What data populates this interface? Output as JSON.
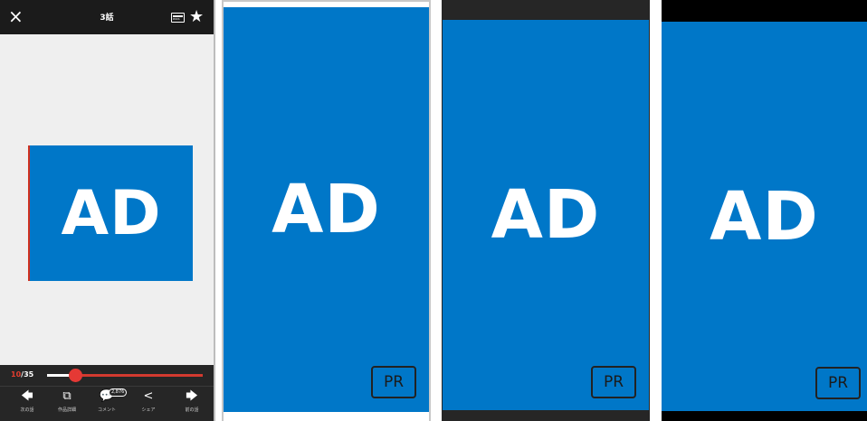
{
  "reader": {
    "close_icon": "×",
    "title": "3話",
    "pass_icon": "PASS",
    "star_icon": "★",
    "ad_text": "AD",
    "page_current": "10",
    "page_total": "/35",
    "progress_fraction": 0.18,
    "nav": [
      {
        "icon": "🡄",
        "label": "次の話"
      },
      {
        "icon": "⧉",
        "label": "作品詳細"
      },
      {
        "icon": "💬",
        "label": "コメント",
        "badge": "2,876"
      },
      {
        "icon": "<",
        "label": "シェア"
      },
      {
        "icon": "🡆",
        "label": "前の話"
      }
    ]
  },
  "ads": [
    {
      "text": "AD",
      "pr": "PR"
    },
    {
      "text": "AD",
      "pr": "PR"
    },
    {
      "text": "AD",
      "pr": "PR"
    }
  ],
  "colors": {
    "ad_blue": "#0077c8",
    "accent_red": "#e53935"
  }
}
